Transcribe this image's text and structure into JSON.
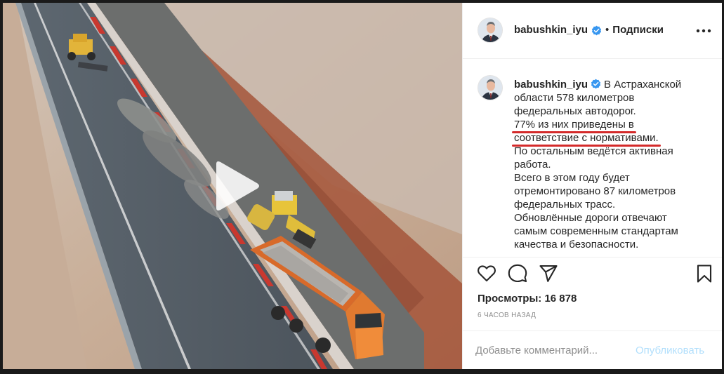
{
  "post": {
    "username": "babushkin_iyu",
    "separator": "•",
    "follow_state": "Подписки",
    "more_icon": "more-horizontal-icon",
    "verified_icon": "verified-badge-icon"
  },
  "caption": {
    "username": "babushkin_iyu",
    "lines": [
      "В Астраханской",
      "области 578 километров",
      "федеральных автодорог.",
      "77% из них приведены в",
      "соответствие с нормативами.",
      "По остальным ведётся активная",
      "работа.",
      "Всего в этом году будет",
      "отремонтировано 87 километров",
      "федеральных трасс.",
      "Обновлённые дороги отвечают",
      "самым современным стандартам",
      "качества и безопасности."
    ],
    "highlight_color": "#d42a2a"
  },
  "actions": {
    "like_icon": "heart-icon",
    "comment_icon": "comment-icon",
    "share_icon": "send-icon",
    "save_icon": "bookmark-icon"
  },
  "stats": {
    "views_label": "Просмотры:",
    "views_value": "16 878",
    "time_ago": "6 часов назад"
  },
  "comment": {
    "placeholder": "Добавьте комментарий...",
    "post_label": "Опубликовать",
    "post_color": "#b2dffc"
  },
  "video": {
    "play_icon": "play-icon"
  }
}
